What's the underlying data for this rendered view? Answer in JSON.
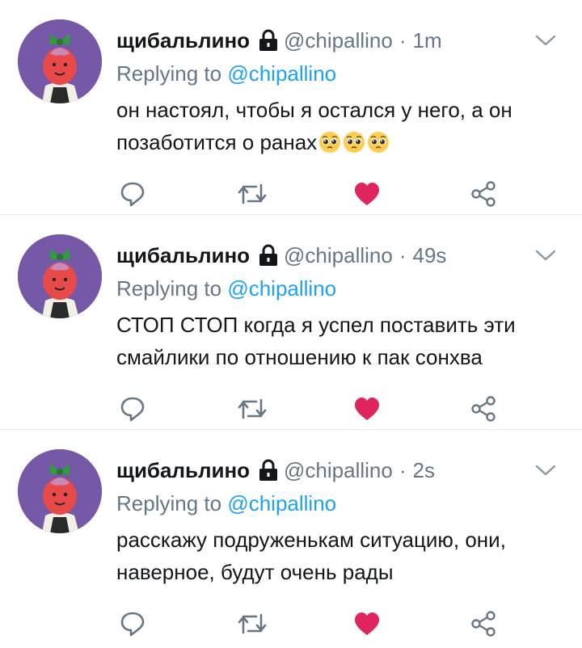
{
  "colors": {
    "text": "#14171a",
    "muted": "#657786",
    "link": "#1da1f2",
    "like": "#e0245e",
    "divider": "#e6ecf0",
    "avatar_bg": "#7558a6"
  },
  "icons": {
    "lock": "lock-icon",
    "more": "chevron-down-icon",
    "reply": "reply-icon",
    "retweet": "retweet-icon",
    "like": "heart-icon",
    "share": "share-icon",
    "emoji": "pleading-face-emoji"
  },
  "tweets": [
    {
      "name": "щибальлино",
      "handle": "@chipallino",
      "separator": "·",
      "time": "1m",
      "replying_prefix": "Replying to",
      "replying_to": "@chipallino",
      "text": "он настоял, чтобы я остался у него, а он позаботится о ранах",
      "emoji_count": 3,
      "liked": true
    },
    {
      "name": "щибальлино",
      "handle": "@chipallino",
      "separator": "·",
      "time": "49s",
      "replying_prefix": "Replying to",
      "replying_to": "@chipallino",
      "text": "СТОП СТОП когда я успел поставить эти смайлики по отношению к пак сонхва",
      "emoji_count": 0,
      "liked": true
    },
    {
      "name": "щибальлино",
      "handle": "@chipallino",
      "separator": "·",
      "time": "2s",
      "replying_prefix": "Replying to",
      "replying_to": "@chipallino",
      "text": "расскажу подруженькам ситуацию, они, наверное, будут очень рады",
      "emoji_count": 0,
      "liked": true
    }
  ]
}
